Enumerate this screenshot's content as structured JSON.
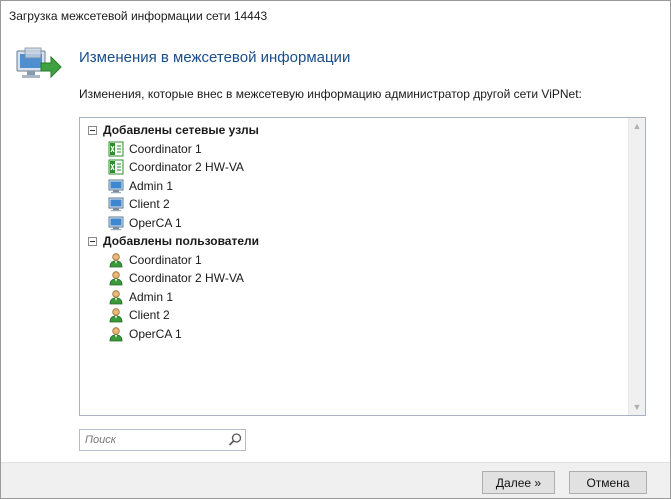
{
  "window": {
    "title": "Загрузка межсетевой информации сети 14443"
  },
  "header": {
    "title": "Изменения в межсетевой информации"
  },
  "description": "Изменения, которые внес в межсетевую информацию администратор другой сети ViPNet:",
  "tree": {
    "groups": [
      {
        "label": "Добавлены сетевые узлы",
        "items": [
          {
            "label": "Coordinator 1",
            "icon": "coordinator-icon"
          },
          {
            "label": "Coordinator 2 HW-VA",
            "icon": "coordinator-icon"
          },
          {
            "label": "Admin 1",
            "icon": "client-computer-icon"
          },
          {
            "label": "Client 2",
            "icon": "client-computer-icon"
          },
          {
            "label": "OperCA 1",
            "icon": "client-computer-icon"
          }
        ]
      },
      {
        "label": "Добавлены пользователи",
        "items": [
          {
            "label": "Coordinator 1",
            "icon": "user-icon"
          },
          {
            "label": "Coordinator 2 HW-VA",
            "icon": "user-icon"
          },
          {
            "label": "Admin 1",
            "icon": "user-icon"
          },
          {
            "label": "Client 2",
            "icon": "user-icon"
          },
          {
            "label": "OperCA 1",
            "icon": "user-icon"
          }
        ]
      }
    ]
  },
  "search": {
    "placeholder": "Поиск",
    "value": ""
  },
  "buttons": {
    "next": "Далее »",
    "cancel": "Отмена"
  },
  "colors": {
    "title_blue": "#1a4e8a",
    "footer_bg": "#f0f0f0",
    "coordinator_green": "#2e8b2e"
  }
}
